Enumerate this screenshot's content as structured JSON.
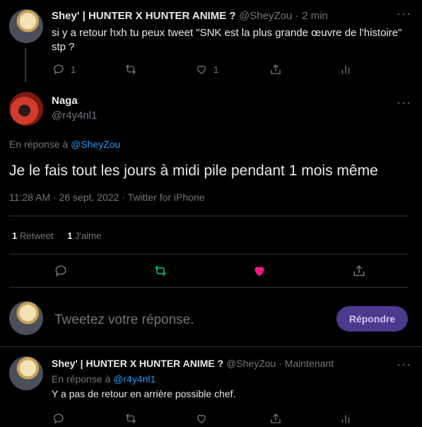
{
  "parent_tweet": {
    "name": "Shey' | HUNTER X HUNTER ANIME ?",
    "handle": "@SheyZou",
    "separator": "·",
    "time": "2 min",
    "text_line1": "si y a retour hxh tu peux tweet \"SNK est la plus grande œuvre de l'histoire\"",
    "text_line2": "stp ?",
    "reply_count": "1",
    "like_count": "1"
  },
  "main_tweet": {
    "name": "Naga",
    "handle": "@r4y4nl1",
    "in_reply_prefix": "En réponse à",
    "in_reply_handle": "@SheyZou",
    "text": "Je le fais tout les jours à midi pile pendant 1 mois même",
    "meta": "11:28 AM · 26 sept. 2022 · Twitter for iPhone",
    "retweet_count": "1",
    "retweet_label": "Retweet",
    "like_count": "1",
    "like_label": "J'aime",
    "colors": {
      "liked": "#f91880",
      "retweeted": "#00ba7c"
    }
  },
  "composer": {
    "placeholder": "Tweetez votre réponse.",
    "reply_button": "Répondre"
  },
  "reply_tweet": {
    "name": "Shey' | HUNTER X HUNTER ANIME ?",
    "handle": "@SheyZou",
    "separator": "·",
    "time": "Maintenant",
    "in_reply_prefix": "En réponse à",
    "in_reply_handle": "@r4y4nl1",
    "text": "Y a pas de retour en arrière possible chef."
  }
}
